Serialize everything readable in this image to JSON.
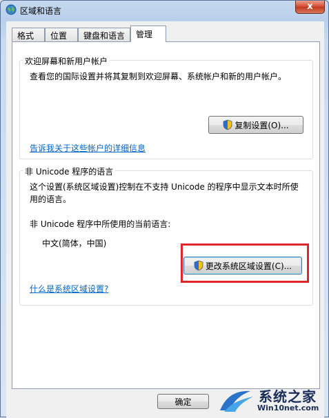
{
  "window": {
    "title": "区域和语言",
    "close_label": "x"
  },
  "tabs": [
    {
      "label": "格式",
      "active": false
    },
    {
      "label": "位置",
      "active": false
    },
    {
      "label": "键盘和语言",
      "active": false
    },
    {
      "label": "管理",
      "active": true
    }
  ],
  "welcome_group": {
    "title": "欢迎屏幕和新用户帐户",
    "description": "查看您的国际设置并将其复制到欢迎屏幕、系统帐户和新的用户帐户。",
    "copy_button": "复制设置(O)...",
    "link": "告诉我关于这些帐户的详细信息"
  },
  "unicode_group": {
    "title": "非 Unicode 程序的语言",
    "description_line1": "这个设置(系统区域设置)控制在不支持 Unicode 的程序中显示文本时所使",
    "description_line2": "用的语言。",
    "current_label": "非 Unicode 程序中所使用的当前语言:",
    "current_value": "中文(简体，中国)",
    "change_button": "更改系统区域设置(C)...",
    "link": "什么是系统区域设置?"
  },
  "footer": {
    "ok_button": "确定"
  },
  "watermark": {
    "title": "系统之家",
    "url": "Win10net.com"
  },
  "colors": {
    "highlight_border": "#e0242b",
    "link": "#0066cc"
  }
}
